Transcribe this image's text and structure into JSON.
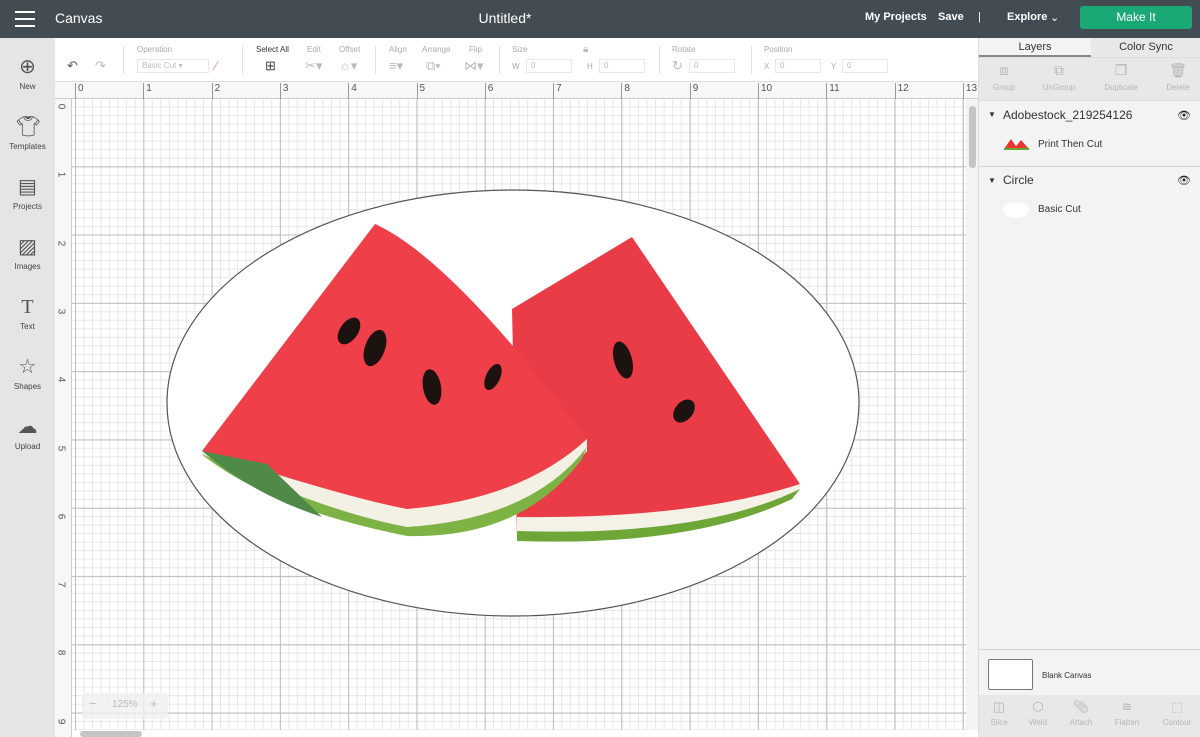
{
  "header": {
    "app": "Canvas",
    "title": "Untitled*",
    "my_projects": "My Projects",
    "save": "Save",
    "divider": "|",
    "explore": "Explore",
    "make_it": "Make It"
  },
  "sidebar": {
    "items": [
      {
        "label": "New",
        "icon": "plus-circle-icon"
      },
      {
        "label": "Templates",
        "icon": "tshirt-icon"
      },
      {
        "label": "Projects",
        "icon": "notebook-icon"
      },
      {
        "label": "Images",
        "icon": "image-icon"
      },
      {
        "label": "Text",
        "icon": "text-icon"
      },
      {
        "label": "Shapes",
        "icon": "shapes-icon"
      },
      {
        "label": "Upload",
        "icon": "cloud-upload-icon"
      }
    ]
  },
  "toolbar": {
    "operation_label": "Operation",
    "operation_value": "Basic Cut",
    "select_all": "Select All",
    "edit": "Edit",
    "offset": "Offset",
    "align": "Align",
    "arrange": "Arrange",
    "flip": "Flip",
    "size": "Size",
    "w": "W",
    "h": "H",
    "w_value": "0",
    "h_value": "0",
    "rotate": "Rotate",
    "rotate_value": "0",
    "position": "Position",
    "x": "X",
    "y": "Y",
    "x_value": "0",
    "y_value": "0"
  },
  "ruler": {
    "top": [
      "0",
      "1",
      "2",
      "3",
      "4",
      "5",
      "6",
      "7",
      "8",
      "9",
      "10",
      "11",
      "12",
      "13"
    ],
    "left": [
      "0",
      "1",
      "2",
      "3",
      "4",
      "5",
      "6",
      "7",
      "8",
      "9"
    ]
  },
  "zoom": {
    "minus": "−",
    "value": "125%",
    "plus": "+"
  },
  "panel": {
    "tabs": [
      "Layers",
      "Color Sync"
    ],
    "active_tab": "Layers",
    "tools": [
      "Group",
      "UnGroup",
      "Duplicate",
      "Delete"
    ],
    "layers": [
      {
        "name": "Adobestock_219254126",
        "sub": "Print Then Cut"
      },
      {
        "name": "Circle",
        "sub": "Basic Cut"
      }
    ],
    "blank_canvas": "Blank Canvas",
    "bottom_tools": [
      "Slice",
      "Weld",
      "Attach",
      "Flatten",
      "Contour"
    ]
  },
  "colors": {
    "topbar": "#434c53",
    "make_it": "#1aa875",
    "flesh": "#ec3b45",
    "rind": "#7cb342"
  }
}
